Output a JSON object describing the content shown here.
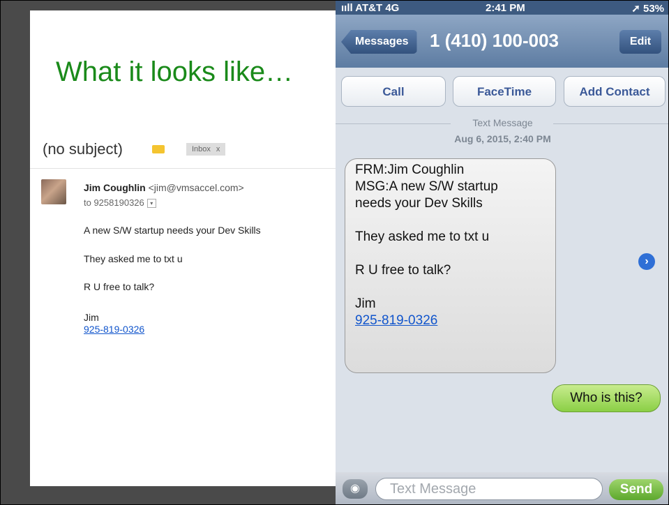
{
  "slide": {
    "title": "What it looks like…"
  },
  "email": {
    "subject": "(no subject)",
    "label_chip": "Inbox",
    "label_chip_close": "x",
    "sender_name": "Jim Coughlin",
    "sender_email": "<jim@vmsaccel.com>",
    "to_line": "to 9258190326",
    "body_lines": [
      "A new S/W startup needs your Dev Skills",
      "They asked me to txt u",
      "R U free to talk?",
      "Jim"
    ],
    "phone_link": "925-819-0326"
  },
  "phone": {
    "status": {
      "carrier": "ııll AT&T 4G",
      "time": "2:41 PM",
      "battery": "➚ 53%"
    },
    "nav": {
      "back_label": "Messages",
      "title": "1 (410) 100-003",
      "edit_label": "Edit"
    },
    "actions": {
      "call": "Call",
      "facetime": "FaceTime",
      "add_contact": "Add Contact"
    },
    "thread_label": "Text Message",
    "timestamp": "Aug 6, 2015, 2:40 PM",
    "incoming": {
      "lines": [
        "FRM:Jim Coughlin",
        "MSG:A new S/W startup",
        "needs your Dev Skills",
        "They asked me to txt u",
        "R U free to talk?",
        "Jim"
      ],
      "link": "925-819-0326"
    },
    "outgoing": "Who is this?",
    "composer": {
      "placeholder": "Text Message",
      "send_label": "Send"
    }
  }
}
